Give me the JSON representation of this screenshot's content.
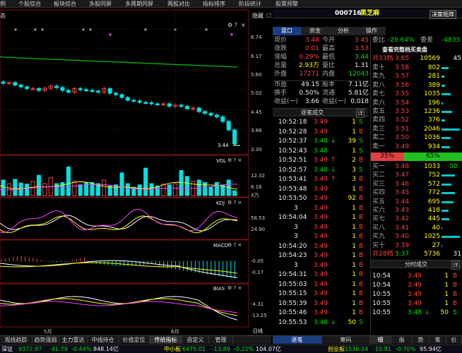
{
  "menu": {
    "items": [
      "例",
      "个股综合",
      "板块综合",
      "多股同屏",
      "多周期同屏",
      "两股对比",
      "指标排序",
      "阶段统计",
      "股票预警"
    ]
  },
  "chart_panel": {
    "left_label": "态",
    "hide_label": "隐藏",
    "fold_label": "□",
    "price_ticks": [
      "6.74",
      "6.17",
      "5.60",
      "5.02",
      "4.45",
      "3.88",
      "3.30"
    ],
    "price_low_label": "3.44",
    "vol_label": "VOL",
    "vol_ticks": [
      "12.32",
      "6.16",
      "X万"
    ],
    "kdj_label": "KDJ",
    "kdj_ticks": [
      "58.53",
      "24.90"
    ],
    "macd_label": "MACD",
    "macd_ticks": [
      "-0.05",
      "-0.17"
    ],
    "bias_label": "BIAS",
    "bias_ticks": [
      "-4.31",
      "-13.25"
    ],
    "month_labels": [
      "5月",
      "6月"
    ],
    "daily_label": "日线"
  },
  "chart_data": [
    {
      "type": "candlestick",
      "title": "",
      "ylim": [
        3.3,
        6.74
      ],
      "y_ticks": [
        6.74,
        6.17,
        5.6,
        5.02,
        4.45,
        3.88,
        3.3
      ],
      "close_approx": [
        5.2,
        5.22,
        5.15,
        5.1,
        5.05,
        5.05,
        5.0,
        5.06,
        5.12,
        5.08,
        5.0,
        4.95,
        5.05,
        5.02,
        5.0,
        4.98,
        4.95,
        5.05,
        4.92,
        4.88,
        4.8,
        4.72,
        4.7,
        4.66,
        4.65,
        4.62,
        4.6,
        4.62,
        4.55,
        4.58,
        4.55,
        4.48,
        4.5,
        4.4,
        4.35,
        4.3,
        4.25,
        4.12,
        3.88,
        3.48
      ],
      "moving_average_approx": [
        5.95,
        5.92,
        5.9,
        5.88,
        5.86,
        5.84,
        5.82,
        5.8,
        5.78,
        5.76,
        5.74,
        5.72,
        5.7,
        5.68,
        5.66
      ],
      "annotation_low": 3.44
    },
    {
      "type": "bar",
      "title": "VOL",
      "y_ticks": [
        12.32,
        6.16
      ],
      "unit": "X万",
      "values": [
        6.5,
        5.0,
        6.8,
        5.2,
        4.8,
        6.0,
        8.5,
        5.0,
        7.5,
        5.0,
        5.5,
        12.0,
        6.0,
        4.5,
        5.5,
        5.5,
        5.0,
        6.5,
        4.0,
        4.5,
        9.5,
        5.0,
        3.5,
        4.5,
        11.5,
        5.0,
        4.0,
        4.8,
        4.5,
        5.0,
        10.5,
        8.0,
        6.0,
        6.5,
        5.5,
        3.5,
        5.5,
        4.5,
        6.5,
        2.0
      ]
    },
    {
      "type": "line",
      "title": "KDJ",
      "y_ticks": [
        58.53,
        24.9
      ]
    },
    {
      "type": "bar",
      "title": "MACD",
      "y_ticks": [
        -0.05,
        -0.17
      ]
    },
    {
      "type": "line",
      "title": "BIAS",
      "y_ticks": [
        -4.31,
        -13.25
      ]
    }
  ],
  "header": {
    "code": "000716",
    "name": "黑芝麻",
    "decision_label": "决策矩阵"
  },
  "rtabs_top": [
    "盘口",
    "资金",
    "分析",
    "操作"
  ],
  "quote": {
    "rows": [
      [
        "现价",
        "3.48",
        "今开",
        "3.45"
      ],
      [
        "涨跌",
        "0.01",
        "最高",
        "3.53"
      ],
      [
        "涨幅",
        "0.29%",
        "最低",
        "3.44"
      ],
      [
        "总量",
        "2.93万",
        "量比",
        "1.31"
      ],
      [
        "外盘",
        "17271",
        "内盘",
        "12043"
      ],
      [
        "市盈",
        "49.15",
        "股本",
        "7.11亿"
      ],
      [
        "换手",
        "0.50%",
        "流通",
        "5.81亿"
      ],
      [
        "收益(一)",
        "3.66",
        "收益(一)",
        "0.018"
      ]
    ]
  },
  "ticks_header": {
    "title": "逐笔成交",
    "detail": "详"
  },
  "ticks": [
    {
      "time": "10:52:18",
      "price": "3.49",
      "arrow": "",
      "vol": "1",
      "bs": "S"
    },
    {
      "time": "10:52:28",
      "price": "3.49",
      "arrow": "",
      "vol": "1",
      "bs": "B"
    },
    {
      "time": "10:52:37",
      "price": "3.48",
      "arrow": "↓",
      "vol": "39",
      "bs": "S"
    },
    {
      "time": "10:52:43",
      "price": "3.48",
      "arrow": "",
      "vol": "1",
      "bs": "S"
    },
    {
      "time": "10:52:51",
      "price": "3.49",
      "arrow": "↑",
      "vol": "2",
      "bs": "B"
    },
    {
      "time": "10:52:57",
      "price": "3.48",
      "arrow": "↓",
      "vol": "3",
      "bs": "S"
    },
    {
      "time": "10:53:41",
      "price": "3.49",
      "arrow": "↑",
      "vol": "3",
      "bs": "B"
    },
    {
      "time": "10:53:48",
      "price": "3.49",
      "arrow": "",
      "vol": "1",
      "bs": "B"
    },
    {
      "time": "10:53:50",
      "price": "3.49",
      "arrow": "",
      "vol": "92",
      "bs": "B"
    },
    {
      "time": "3",
      "price": "3.49",
      "arrow": "",
      "vol": "1",
      "bs": "B"
    },
    {
      "time": "10:54:04",
      "price": "3.49",
      "arrow": "",
      "vol": "1",
      "bs": "B"
    },
    {
      "time": "3",
      "price": "3.49",
      "arrow": "",
      "vol": "1",
      "bs": "B"
    },
    {
      "time": "3",
      "price": "3.49",
      "arrow": "",
      "vol": "1",
      "bs": "B"
    },
    {
      "time": "10:54:20",
      "price": "3.49",
      "arrow": "",
      "vol": "1",
      "bs": "B"
    },
    {
      "time": "10:54:23",
      "price": "3.49",
      "arrow": "",
      "vol": "1",
      "bs": "B"
    },
    {
      "time": "3",
      "price": "3.49",
      "arrow": "",
      "vol": "1",
      "bs": "B"
    },
    {
      "time": "10:54:31",
      "price": "3.49",
      "arrow": "",
      "vol": "1",
      "bs": "B"
    },
    {
      "time": "10:55:03",
      "price": "3.49",
      "arrow": "",
      "vol": "1",
      "bs": "B"
    },
    {
      "time": "10:55:15",
      "price": "3.49",
      "arrow": "",
      "vol": "1",
      "bs": "B"
    },
    {
      "time": "10:55:39",
      "price": "3.49",
      "arrow": "",
      "vol": "1",
      "bs": "B"
    },
    {
      "time": "10:55:46",
      "price": "3.49",
      "arrow": "",
      "vol": "1",
      "bs": "B"
    },
    {
      "time": "10:55:53",
      "price": "3.48",
      "arrow": "↓",
      "vol": "50",
      "bs": "S"
    }
  ],
  "orderbook": {
    "weibi_label": "委比",
    "weibi_value": "-29.64%",
    "weicha_label": "委差",
    "weicha_value": "-4833",
    "full_label": "查看完整档买卖盘",
    "sell_total": {
      "label": "共33档",
      "price": "3.65",
      "vol": "10569",
      "n": "45"
    },
    "sells": [
      [
        "卖十",
        "3.58",
        "802"
      ],
      [
        "卖九",
        "3.57",
        "281"
      ],
      [
        "卖八",
        "3.56",
        "389"
      ],
      [
        "卖七",
        "3.55",
        "1035"
      ],
      [
        "卖六",
        "3.54",
        "196"
      ],
      [
        "卖五",
        "3.53",
        "1236"
      ],
      [
        "卖四",
        "3.52",
        "376"
      ],
      [
        "卖三",
        "3.51",
        "2046"
      ],
      [
        "卖二",
        "3.50",
        "1036"
      ],
      [
        "卖一",
        "3.49",
        "934"
      ]
    ],
    "ratio_left": "35%",
    "ratio_right": "65%",
    "buys": [
      [
        "买一",
        "3.48",
        "1033",
        "-50"
      ],
      [
        "买二",
        "3.47",
        "752",
        ""
      ],
      [
        "买三",
        "3.46",
        "572",
        ""
      ],
      [
        "买四",
        "3.45",
        "772",
        ""
      ],
      [
        "买五",
        "3.44",
        "695",
        ""
      ],
      [
        "买六",
        "3.43",
        "418",
        ""
      ],
      [
        "买七",
        "3.42",
        "445",
        ""
      ],
      [
        "买八",
        "3.41",
        "40",
        ""
      ],
      [
        "买九",
        "3.40",
        "1025",
        ""
      ],
      [
        "买十",
        "3.39",
        "27",
        ""
      ]
    ],
    "buy_total": {
      "label": "共28档",
      "price": "3.37",
      "vol": "5736",
      "n": "31"
    }
  },
  "minute_trades": {
    "title": "分时成交",
    "detail": "详",
    "rows": [
      [
        "10:54",
        "3.49",
        "1",
        "B"
      ],
      [
        "10:54",
        "3.49",
        "1",
        "B"
      ],
      [
        "10:55",
        "3.49",
        "1",
        "B"
      ],
      [
        "10:55",
        "3.49",
        "1",
        "B"
      ],
      [
        "10:55",
        "3.48",
        "↓",
        "50",
        "S"
      ]
    ]
  },
  "bottom_tabs_left": [
    "观线趋踪",
    "趋势强弱",
    "主力雷达",
    "中线持仓",
    "价值定位",
    "传统指标",
    "自定义",
    "管理"
  ],
  "bottom_tabs_right": [
    "逐笔",
    "筹码",
    "细",
    "指",
    "势",
    "笔",
    "价"
  ],
  "status": {
    "sz_label": "深证",
    "sz_value": "9372.97",
    "sz_change": "-41.79",
    "sz_pct": "-0.44%",
    "sz_amount": "848.14亿",
    "zx_label": "中小板",
    "zx_value": "6475.01",
    "zx_change": "-13.89",
    "zx_pct": "-0.21%",
    "zx_amount": "104.07亿",
    "cy_label": "创业板",
    "cy_value": "1536.24",
    "cy_change": "-10.91",
    "cy_pct": "-0.70%",
    "cy_amount": "95.94亿"
  }
}
